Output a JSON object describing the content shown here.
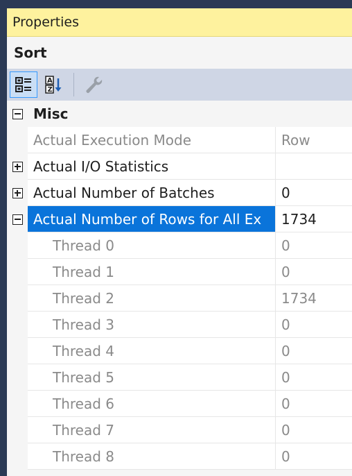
{
  "panel": {
    "title": "Properties",
    "object_name": "Sort"
  },
  "toolbar": {
    "buttons": [
      {
        "icon": "categorized-icon",
        "active": true
      },
      {
        "icon": "alphabetical-sort-icon",
        "active": false
      },
      {
        "icon": "property-pages-wrench-icon",
        "active": false
      }
    ]
  },
  "grid": {
    "category": "Misc",
    "rows": [
      {
        "name": "Actual Execution Mode",
        "value": "Row"
      },
      {
        "name": "Actual I/O Statistics",
        "value": ""
      },
      {
        "name": "Actual Number of Batches",
        "value": "0"
      },
      {
        "name": "Actual Number of Rows for All Ex",
        "value": "1734"
      }
    ],
    "threads": [
      {
        "name": "Thread 0",
        "value": "0"
      },
      {
        "name": "Thread 1",
        "value": "0"
      },
      {
        "name": "Thread 2",
        "value": "1734"
      },
      {
        "name": "Thread 3",
        "value": "0"
      },
      {
        "name": "Thread 4",
        "value": "0"
      },
      {
        "name": "Thread 5",
        "value": "0"
      },
      {
        "name": "Thread 6",
        "value": "0"
      },
      {
        "name": "Thread 7",
        "value": "0"
      },
      {
        "name": "Thread 8",
        "value": "0"
      }
    ]
  },
  "colors": {
    "title_bg": "#fef29e",
    "toolbar_bg": "#cfd6e5",
    "selection": "#0a74da",
    "readonly_text": "#8a8a8a"
  }
}
